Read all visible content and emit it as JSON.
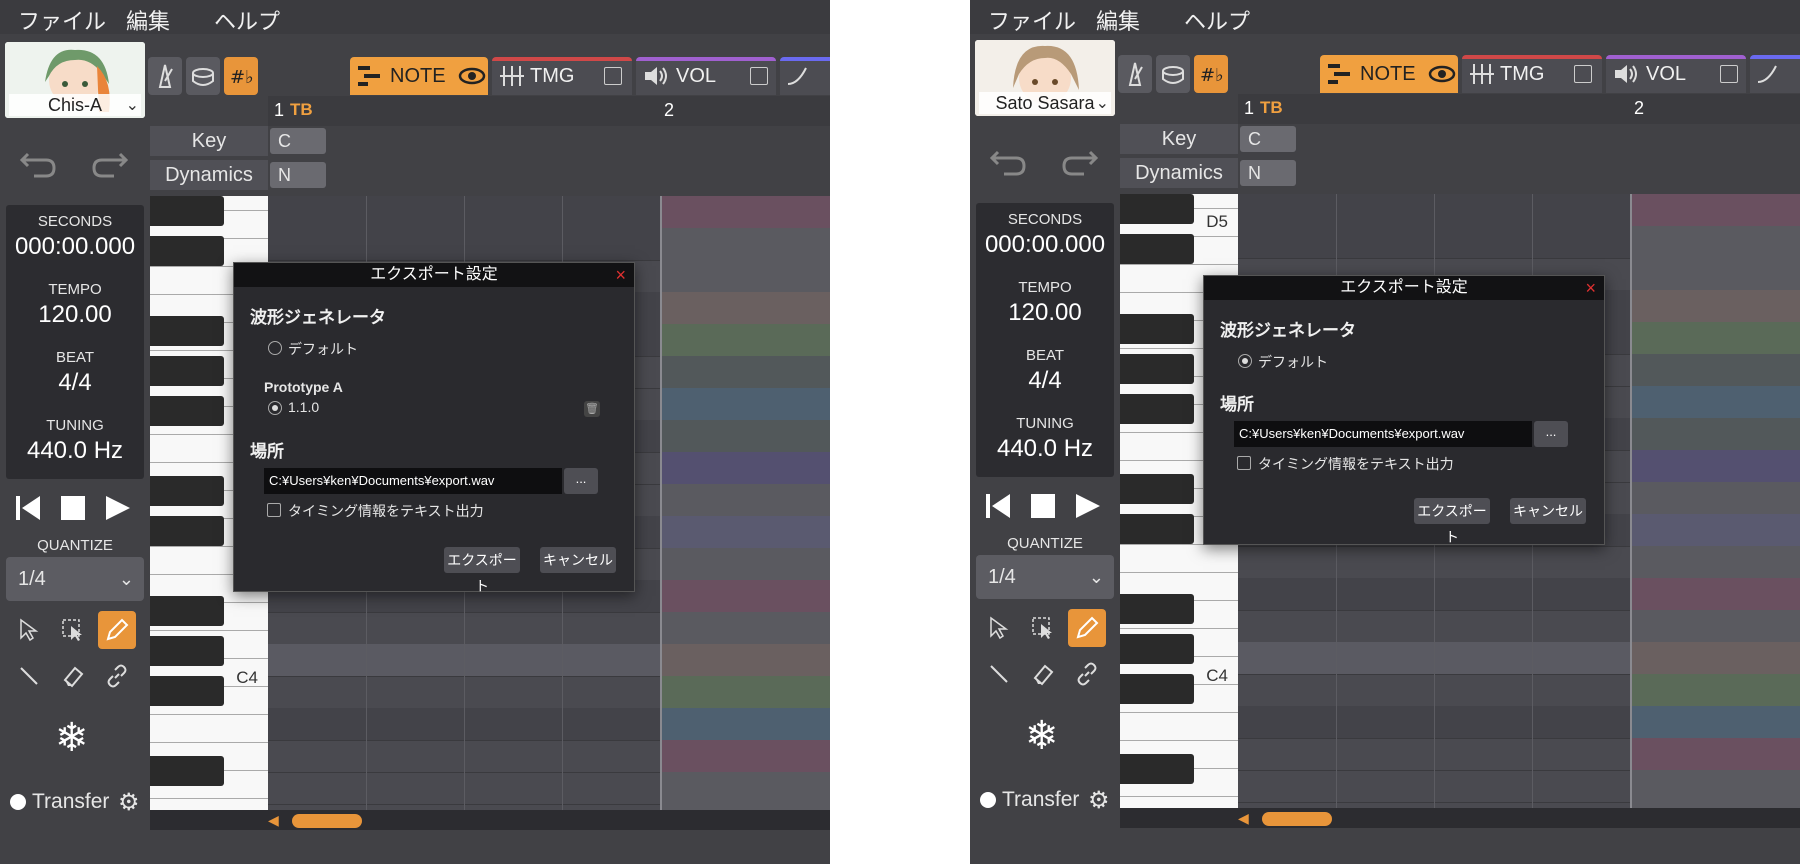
{
  "menu": [
    "ファイル",
    "編集",
    "ヘルプ"
  ],
  "tabs": {
    "note": "NOTE",
    "tmg": "TMG",
    "vol": "VOL"
  },
  "panels": [
    {
      "singer": "Chis-A",
      "undo_icon": "undo-icon",
      "redo_icon": "redo-icon",
      "ruler": {
        "bar1": "1",
        "tb": "TB",
        "bar2": "2"
      },
      "key_row": {
        "label": "Key",
        "value": "C"
      },
      "dyn_row": {
        "label": "Dynamics",
        "value": "N"
      },
      "info": {
        "seconds_label": "SECONDS",
        "seconds_value": "000:00.000",
        "tempo_label": "TEMPO",
        "tempo_value": "120.00",
        "beat_label": "BEAT",
        "beat_value": "4/4",
        "tuning_label": "TUNING",
        "tuning_value": "440.0 Hz"
      },
      "quantize_label": "QUANTIZE",
      "quantize_value": "1/4",
      "transfer_label": "Transfer",
      "key_labels": {
        "c4": "C4",
        "d5": ""
      },
      "dialog": {
        "title": "エクスポート設定",
        "close": "×",
        "section_generator": "波形ジェネレータ",
        "option_default": "デフォルト",
        "engine_name": "Prototype A",
        "engine_version": "1.1.0",
        "section_location": "場所",
        "path": "C:¥Users¥ken¥Documents¥export.wav",
        "browse": "...",
        "timing_checkbox": "タイミング情報をテキスト出力",
        "export_button": "エクスポート",
        "cancel_button": "キャンセル"
      }
    },
    {
      "singer": "Sato Sasara",
      "undo_icon": "undo-icon",
      "redo_icon": "redo-icon",
      "ruler": {
        "bar1": "1",
        "tb": "TB",
        "bar2": "2"
      },
      "key_row": {
        "label": "Key",
        "value": "C"
      },
      "dyn_row": {
        "label": "Dynamics",
        "value": "N"
      },
      "info": {
        "seconds_label": "SECONDS",
        "seconds_value": "000:00.000",
        "tempo_label": "TEMPO",
        "tempo_value": "120.00",
        "beat_label": "BEAT",
        "beat_value": "4/4",
        "tuning_label": "TUNING",
        "tuning_value": "440.0 Hz"
      },
      "quantize_label": "QUANTIZE",
      "quantize_value": "1/4",
      "transfer_label": "Transfer",
      "key_labels": {
        "c4": "C4",
        "d5": "D5"
      },
      "dialog": {
        "title": "エクスポート設定",
        "close": "×",
        "section_generator": "波形ジェネレータ",
        "option_default": "デフォルト",
        "section_location": "場所",
        "path": "C:¥Users¥ken¥Documents¥export.wav",
        "browse": "...",
        "timing_checkbox": "タイミング情報をテキスト出力",
        "export_button": "エクスポート",
        "cancel_button": "キャンセル"
      }
    }
  ],
  "colors": {
    "accent": "#e8953a",
    "tmg_line": "#d04848",
    "vol_line": "#a060d0",
    "close_red": "#e03030"
  }
}
